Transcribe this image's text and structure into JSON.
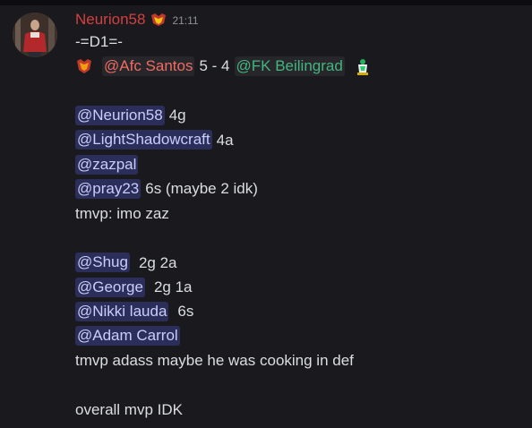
{
  "message": {
    "author": "Neurion58",
    "timestamp": "21:11",
    "colors": {
      "author": "#d2403f",
      "mention_bg": "#5865f2",
      "green": "#43b581"
    },
    "lines": {
      "l1": "-=D1=-",
      "match": {
        "home": "@Afc Santos",
        "score": "5 - 4",
        "away": "@FK Beilingrad"
      },
      "home_stats": [
        {
          "mention": "@Neurion58",
          "text": "4g"
        },
        {
          "mention": "@LightShadowcraft",
          "text": "4a"
        },
        {
          "mention": "@zazpal",
          "text": ""
        },
        {
          "mention": "@pray23",
          "text": "6s (maybe 2 idk)"
        }
      ],
      "home_tmvp": "tmvp: imo zaz",
      "away_stats": [
        {
          "mention": "@Shug",
          "text": "2g 2a"
        },
        {
          "mention": "@George",
          "text": "2g 1a"
        },
        {
          "mention": "@Nikki lauda",
          "text": "6s"
        },
        {
          "mention": "@Adam Carrol",
          "text": ""
        }
      ],
      "away_tmvp": "tmvp adass maybe he was cooking in def",
      "overall": "overall mvp IDK"
    }
  }
}
